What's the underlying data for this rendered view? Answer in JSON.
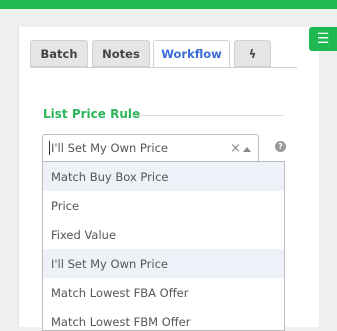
{
  "menu": {
    "icon": "hamburger-menu-icon",
    "glyph": "☰"
  },
  "tabs": [
    {
      "label": "Batch"
    },
    {
      "label": "Notes"
    },
    {
      "label": "Workflow"
    },
    {
      "icon": "lightning-icon",
      "glyph": "ϟ"
    }
  ],
  "section": {
    "title": "List Price Rule"
  },
  "select": {
    "value": "I'll Set My Own Price",
    "clear_glyph": "×"
  },
  "help": {
    "glyph": "?"
  },
  "options": [
    "Match Buy Box Price",
    "Price",
    "Fixed Value",
    "I'll Set My Own Price",
    "Match Lowest FBA Offer",
    "Match Lowest FBM Offer"
  ],
  "colors": {
    "accent": "#1fb952",
    "active_tab": "#3b6bd6",
    "section_title": "#2bb55a"
  }
}
